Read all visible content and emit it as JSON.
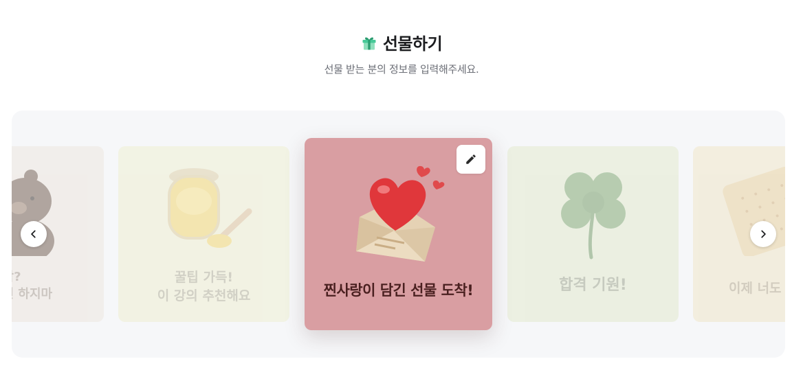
{
  "header": {
    "title": "선물하기",
    "subtitle": "선물 받는 분의 정보를 입력해주세요.",
    "icon": "gift-icon"
  },
  "carousel": {
    "cards": [
      {
        "theme": "bear",
        "text": "시작?\n다긴 하지마",
        "icon": "teddy-bear",
        "bg": "#ece3d9"
      },
      {
        "theme": "honey",
        "text": "꿀팁 가득!\n이 강의 추천해요",
        "icon": "honey-jar",
        "bg": "#eeeec9"
      },
      {
        "theme": "love",
        "text": "찐사랑이 담긴 선물 도착!",
        "icon": "heart-envelope",
        "bg": "#d99ea2",
        "selected": true
      },
      {
        "theme": "clover",
        "text": "합격 기원!",
        "icon": "four-leaf-clover",
        "bg": "#dfe7c6"
      },
      {
        "theme": "cracker",
        "text": "이제 너도",
        "icon": "cracker",
        "bg": "#efe3bf"
      }
    ],
    "edit_icon": "pencil-icon",
    "prev_icon": "chevron-left-icon",
    "next_icon": "chevron-right-icon"
  },
  "colors": {
    "accent_gift": "#3ec28f",
    "selected_card": "#d99ea2",
    "carousel_bg": "#f6f7f9"
  }
}
